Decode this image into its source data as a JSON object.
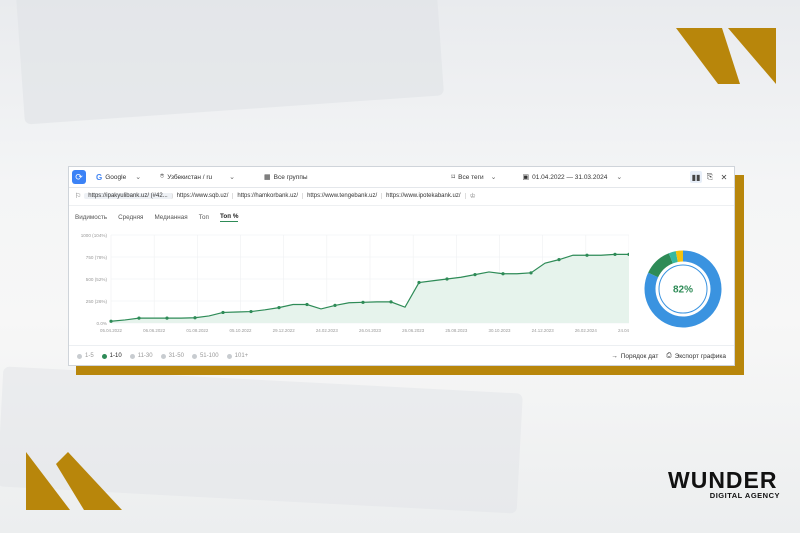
{
  "toolbar": {
    "search_engine": "Google",
    "region": "Узбекистан / ru",
    "groups": "Все группы",
    "tags": "Все теги",
    "date_range": "01.04.2022 — 31.03.2024"
  },
  "urls": [
    "https://ipakyulibank.uz/ (#42...",
    "https://www.sqb.uz/",
    "https://hamkorbank.uz/",
    "https://www.tengebank.uz/",
    "https://www.ipotekabank.uz/"
  ],
  "tabs": [
    "Видимость",
    "Средняя",
    "Медианная",
    "Топ",
    "Топ %"
  ],
  "active_tab": "Топ %",
  "chart_data": {
    "type": "area",
    "x": [
      "05.04.2022",
      "20.04.2022",
      "05.05.2022",
      "20.05.2022",
      "10.06.2022",
      "25.06.2022",
      "10.07.2022",
      "25.07.2022",
      "10.08.2022",
      "01.09.2022",
      "20.09.2022",
      "05.10.2022",
      "25.10.2022",
      "15.11.2022",
      "01.12.2022",
      "20.12.2022",
      "10.01.2023",
      "01.02.2023",
      "20.02.2023",
      "10.03.2023",
      "01.04.2023",
      "20.04.2023",
      "10.05.2023",
      "01.06.2023",
      "26.06.2023",
      "10.07.2023",
      "01.08.2023",
      "25.08.2023",
      "15.09.2023",
      "10.10.2023",
      "01.11.2023",
      "25.11.2023",
      "14.12.2023",
      "05.01.2024",
      "28.01.2024",
      "20.02.2024",
      "15.03.2024",
      "31.03.2024"
    ],
    "values": [
      20,
      35,
      55,
      55,
      55,
      55,
      60,
      80,
      120,
      125,
      130,
      150,
      175,
      210,
      210,
      160,
      200,
      230,
      235,
      240,
      240,
      180,
      460,
      480,
      500,
      520,
      550,
      580,
      560,
      560,
      570,
      680,
      720,
      770,
      770,
      770,
      780,
      780
    ],
    "yticks": [
      "0.0%",
      "250 (26%)",
      "500 (52%)",
      "750 (78%)",
      "1000 (104%)"
    ],
    "ytick_values": [
      0,
      250,
      500,
      750,
      1000
    ],
    "xticks": [
      "05.04.2022",
      "06.06.2022",
      "01.08.2022",
      "05.10.2022",
      "29.12.2022",
      "24.02.2023",
      "26.04.2023",
      "26.06.2023",
      "25.08.2023",
      "30.10.2023",
      "24.12.2023",
      "26.02.2024",
      "24.04.2024"
    ],
    "ylim": [
      0,
      1000
    ],
    "colors": {
      "line": "#2e8b57",
      "fill": "#e6f3ec"
    }
  },
  "donut": {
    "label": "82%",
    "segments": [
      {
        "value": 82,
        "color": "#3a93e0"
      },
      {
        "value": 12,
        "color": "#2e8b57"
      },
      {
        "value": 3,
        "color": "#36b8a0"
      },
      {
        "value": 3,
        "color": "#f4c20d"
      }
    ]
  },
  "legend": [
    "1-5",
    "1-10",
    "11-30",
    "31-50",
    "51-100",
    "101+"
  ],
  "legend_active": "1-10",
  "buttons": {
    "order_dates": "Порядок дат",
    "export_chart": "Экспорт графика"
  },
  "brand": {
    "name": "WUNDER",
    "tagline": "DIGITAL AGENCY",
    "accent": "#b8860b"
  }
}
